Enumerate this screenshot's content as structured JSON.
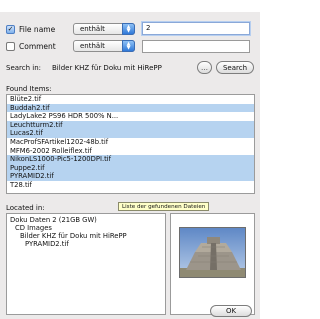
{
  "criteria": {
    "file_name": {
      "checkbox_label": "File name",
      "checked": true,
      "operator": "enthält",
      "value": "2"
    },
    "comment": {
      "checkbox_label": "Comment",
      "checked": false,
      "operator": "enthält",
      "value": ""
    }
  },
  "search_in": {
    "label": "Search in:",
    "location": "Bilder KHZ für Doku mit HiRePP",
    "search_button": "Search",
    "choose_icon": "ellipsis-icon"
  },
  "found_items": {
    "label": "Found Items:",
    "items": [
      {
        "name": "Blüte2.tif",
        "selected": false
      },
      {
        "name": "Buddah2.tif",
        "selected": true
      },
      {
        "name": "LadyLake2 PS96 HDR 500% N...",
        "selected": false
      },
      {
        "name": "Leuchtturm2.tif",
        "selected": true
      },
      {
        "name": "Lucas2.tif",
        "selected": true
      },
      {
        "name": "MacProfSFArtikel1202-48b.tif",
        "selected": false
      },
      {
        "name": "MFM6-2002 Rolleiflex.tif",
        "selected": false
      },
      {
        "name": "NikonLS1000-Pic5-1200DPI.tif",
        "selected": true
      },
      {
        "name": "Puppe2.tif",
        "selected": true
      },
      {
        "name": "PYRAMID2.tif",
        "selected": true
      },
      {
        "name": "T28.tif",
        "selected": false
      }
    ],
    "tooltip": "Liste der gefundenen Dateien"
  },
  "located_in": {
    "label": "Located in:",
    "path": [
      "Doku Daten 2 (21GB GW)",
      "CD Images",
      "Bilder KHZ für Doku mit HiRePP",
      "PYRAMID2.tif"
    ]
  },
  "preview": {
    "ok_button": "OK"
  },
  "colors": {
    "selection": "#b6d3f0",
    "accent": "#2f78d8",
    "tooltip_bg": "#ffffc8"
  }
}
